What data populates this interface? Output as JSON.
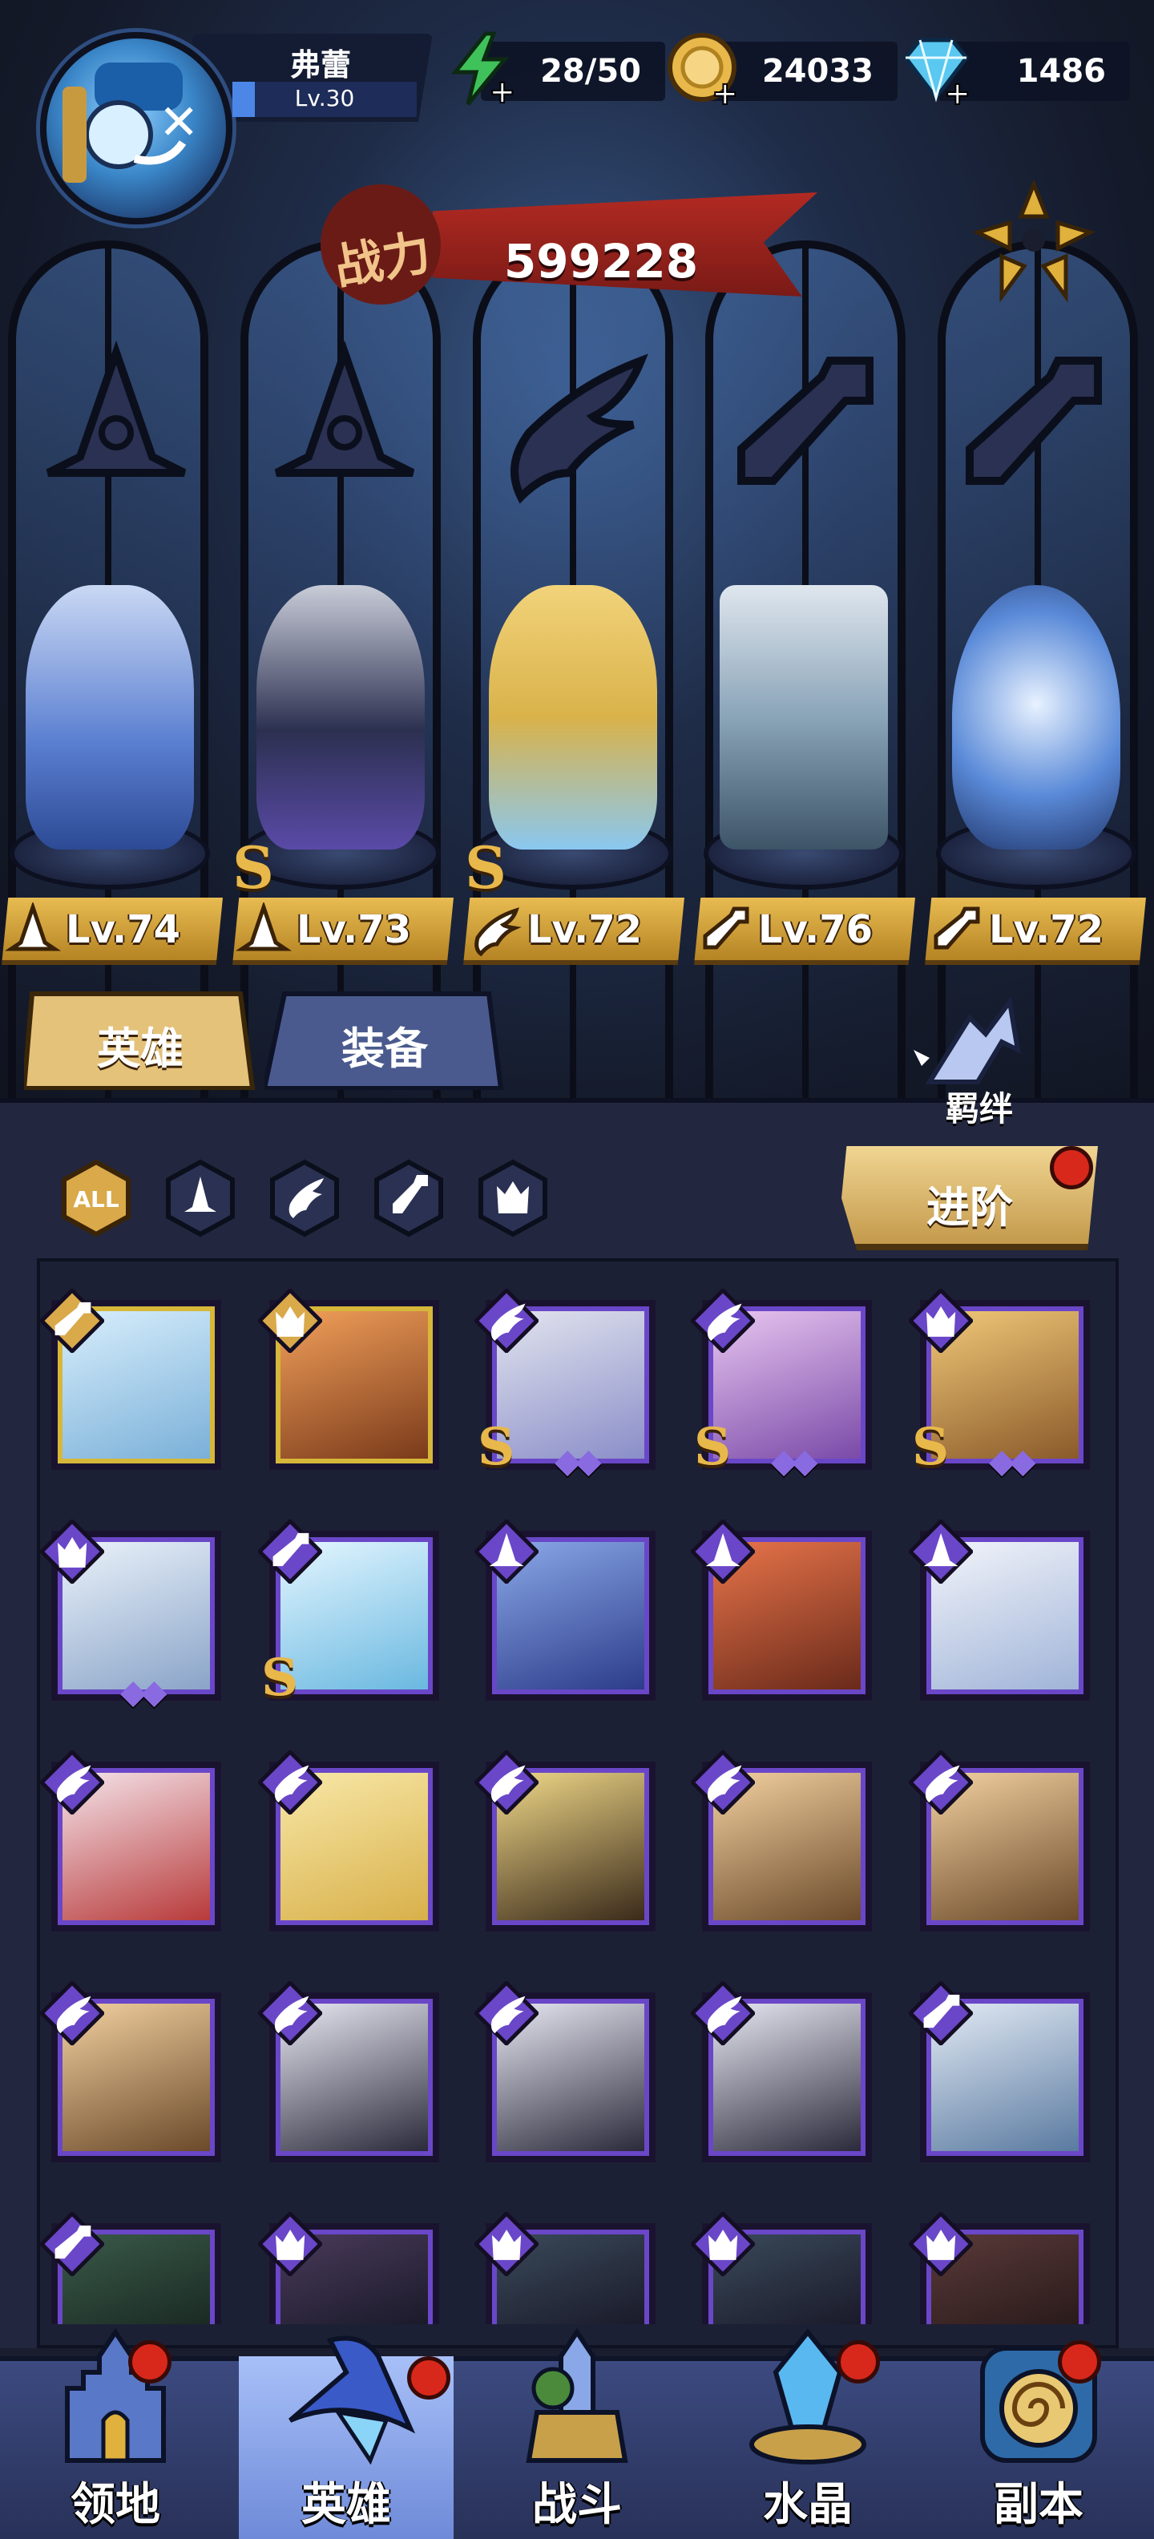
{
  "player": {
    "name": "弗蕾",
    "level": "Lv.30"
  },
  "resources": {
    "stamina": "28/50",
    "gold": "24033",
    "gems": "1486"
  },
  "power": {
    "label": "战力",
    "value": "599228"
  },
  "lineup": [
    {
      "level": "Lv.74",
      "class": "mage",
      "rank_s": false
    },
    {
      "level": "Lv.73",
      "class": "mage",
      "rank_s": true
    },
    {
      "level": "Lv.72",
      "class": "wing",
      "rank_s": true
    },
    {
      "level": "Lv.76",
      "class": "wrench",
      "rank_s": false
    },
    {
      "level": "Lv.72",
      "class": "wrench",
      "rank_s": false
    }
  ],
  "tabs": {
    "heroes": "英雄",
    "equipment": "装备"
  },
  "bond_label": "羁绊",
  "filters": {
    "all": "ALL"
  },
  "advance_label": "进阶",
  "colors": {
    "gold": "#e8b84b",
    "purple_frame": "#6a47c8",
    "gold_frame": "#d6b73a",
    "red_dot": "#d8281c"
  },
  "roster": [
    {
      "class": "wrench",
      "frame": "gold",
      "s": false,
      "stars": 0
    },
    {
      "class": "beast",
      "frame": "gold",
      "s": false,
      "stars": 0
    },
    {
      "class": "wing",
      "frame": "purple",
      "s": true,
      "stars": 2
    },
    {
      "class": "wing",
      "frame": "purple",
      "s": true,
      "stars": 2
    },
    {
      "class": "beast",
      "frame": "purple",
      "s": true,
      "stars": 2
    },
    {
      "class": "beast",
      "frame": "purple",
      "s": false,
      "stars": 2
    },
    {
      "class": "wrench",
      "frame": "purple",
      "s": true,
      "stars": 0
    },
    {
      "class": "mage",
      "frame": "purple",
      "s": false,
      "stars": 0
    },
    {
      "class": "mage",
      "frame": "purple",
      "s": false,
      "stars": 0
    },
    {
      "class": "mage",
      "frame": "purple",
      "s": false,
      "stars": 0
    },
    {
      "class": "wing",
      "frame": "purple",
      "s": false,
      "stars": 0
    },
    {
      "class": "wing",
      "frame": "purple",
      "s": false,
      "stars": 0
    },
    {
      "class": "wing",
      "frame": "purple",
      "s": false,
      "stars": 0
    },
    {
      "class": "wing",
      "frame": "purple",
      "s": false,
      "stars": 0
    },
    {
      "class": "wing",
      "frame": "purple",
      "s": false,
      "stars": 0
    },
    {
      "class": "wing",
      "frame": "purple",
      "s": false,
      "stars": 0
    },
    {
      "class": "wing",
      "frame": "purple",
      "s": false,
      "stars": 0
    },
    {
      "class": "wing",
      "frame": "purple",
      "s": false,
      "stars": 0
    },
    {
      "class": "wing",
      "frame": "purple",
      "s": false,
      "stars": 0
    },
    {
      "class": "wrench",
      "frame": "purple",
      "s": false,
      "stars": 0
    },
    {
      "class": "wrench",
      "frame": "purple",
      "s": false,
      "stars": 0
    },
    {
      "class": "beast",
      "frame": "purple",
      "s": false,
      "stars": 0
    },
    {
      "class": "beast",
      "frame": "purple",
      "s": false,
      "stars": 0
    },
    {
      "class": "beast",
      "frame": "purple",
      "s": false,
      "stars": 0
    },
    {
      "class": "beast",
      "frame": "purple",
      "s": false,
      "stars": 0
    }
  ],
  "nav": [
    {
      "label": "领地",
      "dot": true
    },
    {
      "label": "英雄",
      "dot": true,
      "active": true
    },
    {
      "label": "战斗",
      "dot": false
    },
    {
      "label": "水晶",
      "dot": true
    },
    {
      "label": "副本",
      "dot": true
    }
  ]
}
